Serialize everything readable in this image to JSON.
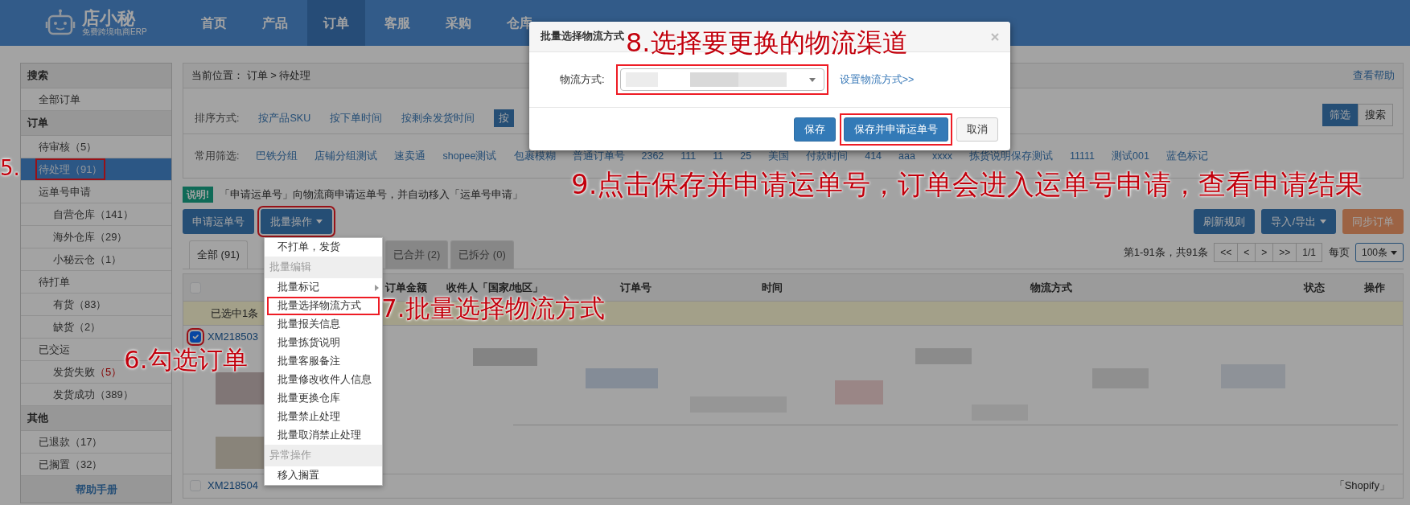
{
  "navbar": {
    "logo": "店小秘",
    "tagline": "免费跨境电商ERP",
    "items": [
      {
        "label": "首页",
        "selected": false
      },
      {
        "label": "产品",
        "selected": false
      },
      {
        "label": "订单",
        "selected": true
      },
      {
        "label": "客服",
        "selected": false
      },
      {
        "label": "采购",
        "selected": false
      },
      {
        "label": "仓库",
        "selected": false
      }
    ]
  },
  "sidebar": {
    "groups": [
      {
        "title": "搜索",
        "items": [
          {
            "label": "全部订单",
            "selected": false,
            "highlighted": false,
            "alert": false
          }
        ]
      },
      {
        "title": "订单",
        "items": [
          {
            "label": "待审核",
            "count": "（5）",
            "selected": false,
            "highlighted": false,
            "alert": false
          },
          {
            "label": "待处理",
            "count": "（91）",
            "selected": true,
            "highlighted": true,
            "alert": false
          },
          {
            "label": "运单号申请",
            "selected": false,
            "highlighted": false,
            "alert": false,
            "children": [
              {
                "label": "自营仓库",
                "count": "（141）",
                "selected": false,
                "highlighted": false,
                "alert": false
              },
              {
                "label": "海外仓库",
                "count": "（29）",
                "selected": false,
                "highlighted": false,
                "alert": false
              },
              {
                "label": "小秘云仓",
                "count": "（1）",
                "selected": false,
                "highlighted": false,
                "alert": false
              }
            ]
          },
          {
            "label": "待打单",
            "selected": false,
            "highlighted": false,
            "alert": false,
            "children": [
              {
                "label": "有货",
                "count": "（83）",
                "selected": false,
                "highlighted": false,
                "alert": false
              },
              {
                "label": "缺货",
                "count": "（2）",
                "selected": false,
                "highlighted": false,
                "alert": false
              }
            ]
          },
          {
            "label": "已交运",
            "selected": false,
            "highlighted": false,
            "alert": false,
            "children": [
              {
                "label": "发货失败",
                "count": "（5）",
                "selected": false,
                "highlighted": false,
                "alert": true
              },
              {
                "label": "发货成功",
                "count": "（389）",
                "selected": false,
                "highlighted": false,
                "alert": false
              }
            ]
          }
        ]
      },
      {
        "title": "其他",
        "items": [
          {
            "label": "已退款",
            "count": "（17）",
            "selected": false,
            "highlighted": false,
            "alert": false
          },
          {
            "label": "已搁置",
            "count": "（32）",
            "selected": false,
            "highlighted": false,
            "alert": false
          }
        ]
      }
    ],
    "help_link": "帮助手册"
  },
  "breadcrumb": {
    "label": "当前位置：",
    "path": "订单 > 待处理",
    "help": "查看帮助"
  },
  "sort": {
    "label": "排序方式:",
    "options": [
      {
        "label": "按产品SKU",
        "selected": false
      },
      {
        "label": "按下单时间",
        "selected": false
      },
      {
        "label": "按剩余发货时间",
        "selected": false
      },
      {
        "label": "按",
        "selected": true
      }
    ]
  },
  "view_toggle": [
    {
      "label": "筛选",
      "selected": true
    },
    {
      "label": "搜索",
      "selected": false
    }
  ],
  "filters": {
    "label": "常用筛选:",
    "items": [
      "巴铁分组",
      "店铺分组测试",
      "速卖通",
      "shopee测试",
      "包裹模糊",
      "普通订单号",
      "2362",
      "111",
      "11",
      "25",
      "美国",
      "付款时间",
      "414",
      "aaa",
      "xxxx",
      "拣货说明保存测试",
      "11111",
      "测试001",
      "蓝色标记"
    ]
  },
  "notice": {
    "badge": "说明!",
    "text": "「申请运单号」向物流商申请运单号，并自动移入「运单号申请」"
  },
  "actions_left": [
    {
      "label": "申请运单号",
      "dropdown": false,
      "highlighted": false
    },
    {
      "label": "批量操作",
      "dropdown": true,
      "highlighted": true
    }
  ],
  "actions_right": [
    {
      "label": "刷新规则",
      "dropdown": false,
      "kind": "primary"
    },
    {
      "label": "导入/导出",
      "dropdown": true,
      "kind": "primary"
    },
    {
      "label": "同步订单",
      "dropdown": false,
      "kind": "warning"
    }
  ],
  "tabs": [
    {
      "label": "全部 (91)",
      "selected": true
    },
    {
      "label": "已合并 (2)",
      "selected": false
    },
    {
      "label": "已拆分 (0)",
      "selected": false
    }
  ],
  "pager": {
    "summary": "第1-91条，共91条",
    "buttons": [
      "<<",
      "<",
      ">",
      ">>",
      "1/1"
    ],
    "per_page_label": "每页",
    "per_page": "100条"
  },
  "table": {
    "columns": [
      "订单金额",
      "收件人「国家/地区」",
      "订单号",
      "时间",
      "物流方式",
      "状态",
      "操作"
    ],
    "select_all_checked": false,
    "selection_note": "已选中1条",
    "rows": [
      {
        "order_no": "XM218503",
        "checked": true,
        "highlighted": true
      },
      {
        "order_no": "XM218504",
        "checked": false,
        "highlighted": false,
        "store": "「Shopify」"
      }
    ]
  },
  "batch_menu": {
    "items": [
      {
        "kind": "item",
        "label": "不打单，发货",
        "highlighted": false,
        "submenu": false
      },
      {
        "kind": "header",
        "label": "批量编辑"
      },
      {
        "kind": "item",
        "label": "批量标记",
        "highlighted": false,
        "submenu": true
      },
      {
        "kind": "item",
        "label": "批量选择物流方式",
        "highlighted": true,
        "submenu": false
      },
      {
        "kind": "item",
        "label": "批量报关信息",
        "highlighted": false,
        "submenu": false
      },
      {
        "kind": "item",
        "label": "批量拣货说明",
        "highlighted": false,
        "submenu": false
      },
      {
        "kind": "item",
        "label": "批量客服备注",
        "highlighted": false,
        "submenu": false
      },
      {
        "kind": "item",
        "label": "批量修改收件人信息",
        "highlighted": false,
        "submenu": false
      },
      {
        "kind": "item",
        "label": "批量更换仓库",
        "highlighted": false,
        "submenu": false
      },
      {
        "kind": "item",
        "label": "批量禁止处理",
        "highlighted": false,
        "submenu": false
      },
      {
        "kind": "item",
        "label": "批量取消禁止处理",
        "highlighted": false,
        "submenu": false
      },
      {
        "kind": "header",
        "label": "异常操作"
      },
      {
        "kind": "item",
        "label": "移入搁置",
        "highlighted": false,
        "submenu": false
      }
    ]
  },
  "modal": {
    "title": "批量选择物流方式",
    "field_label": "物流方式:",
    "select_highlighted": true,
    "link": "设置物流方式>>",
    "buttons": [
      {
        "label": "保存",
        "kind": "primary",
        "highlighted": false
      },
      {
        "label": "保存并申请运单号",
        "kind": "primary",
        "highlighted": true
      },
      {
        "label": "取消",
        "kind": "default",
        "highlighted": false
      }
    ]
  },
  "annotations": [
    {
      "text": "5."
    },
    {
      "text": "6.勾选订单"
    },
    {
      "text": "7.批量选择物流方式"
    },
    {
      "text": "8.选择要更换的物流渠道"
    },
    {
      "text": "9.点击保存并申请运单号，订单会进入运单号申请，查看申请结果"
    }
  ]
}
